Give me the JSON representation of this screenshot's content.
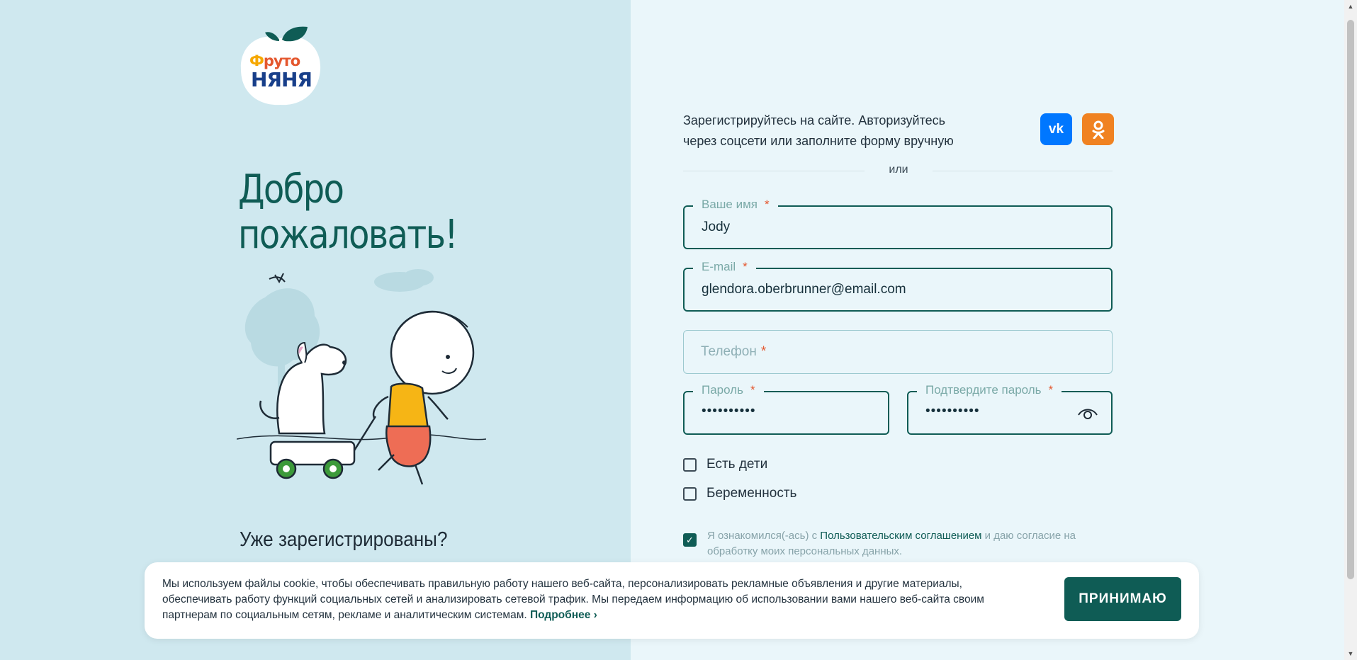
{
  "brand": {
    "logo_top": [
      "Ф",
      "руто"
    ],
    "logo_bottom": "НЯНЯ"
  },
  "left": {
    "welcome_line1": "Добро",
    "welcome_line2": "пожаловать!",
    "already_registered": "Уже зарегистрированы?"
  },
  "form": {
    "intro": "Зарегистрируйтесь на сайте. Авторизуйтесь через соцсети или заполните форму вручную",
    "social": [
      {
        "label": "VK",
        "icon": "vk-icon",
        "color": "#0077ff"
      },
      {
        "label": "OK",
        "icon": "ok-icon",
        "color": "#f08221"
      }
    ],
    "or_label": "или",
    "name": {
      "label": "Ваше имя",
      "value": "Jody",
      "required": "*"
    },
    "email": {
      "label": "E-mail",
      "value": "glendora.oberbrunner@email.com",
      "required": "*"
    },
    "phone": {
      "placeholder": "Телефон",
      "required": "*"
    },
    "password": {
      "label": "Пароль",
      "value": "••••••••••",
      "required": "*"
    },
    "confirm_password": {
      "label": "Подтвердите пароль",
      "value": "••••••••••",
      "required": "*"
    },
    "has_children": {
      "label": "Есть дети",
      "checked": false
    },
    "pregnancy": {
      "label": "Беременность",
      "checked": false
    },
    "consent": {
      "checked": true,
      "before": "Я ознакомился(-ась) с ",
      "link": "Пользовательским соглашением",
      "after": " и даю согласие на обработку моих персональных данных."
    }
  },
  "cookie": {
    "text": "Мы используем файлы cookie, чтобы обеспечивать правильную работу нашего веб-сайта, персонализировать рекламные объявления и другие материалы, обеспечивать работу функций социальных сетей и анализировать сетевой трафик. Мы передаем информацию об использовании вами нашего веб-сайта своим партнерам по социальным сетям, рекламе и аналитическим системам.",
    "more_label": "Подробнее  ›",
    "accept_label": "ПРИНИМАЮ"
  },
  "colors": {
    "accent": "#0f5c55",
    "required": "#e4572e",
    "left_bg": "#cfe8ef",
    "right_bg": "#eaf6fa"
  }
}
